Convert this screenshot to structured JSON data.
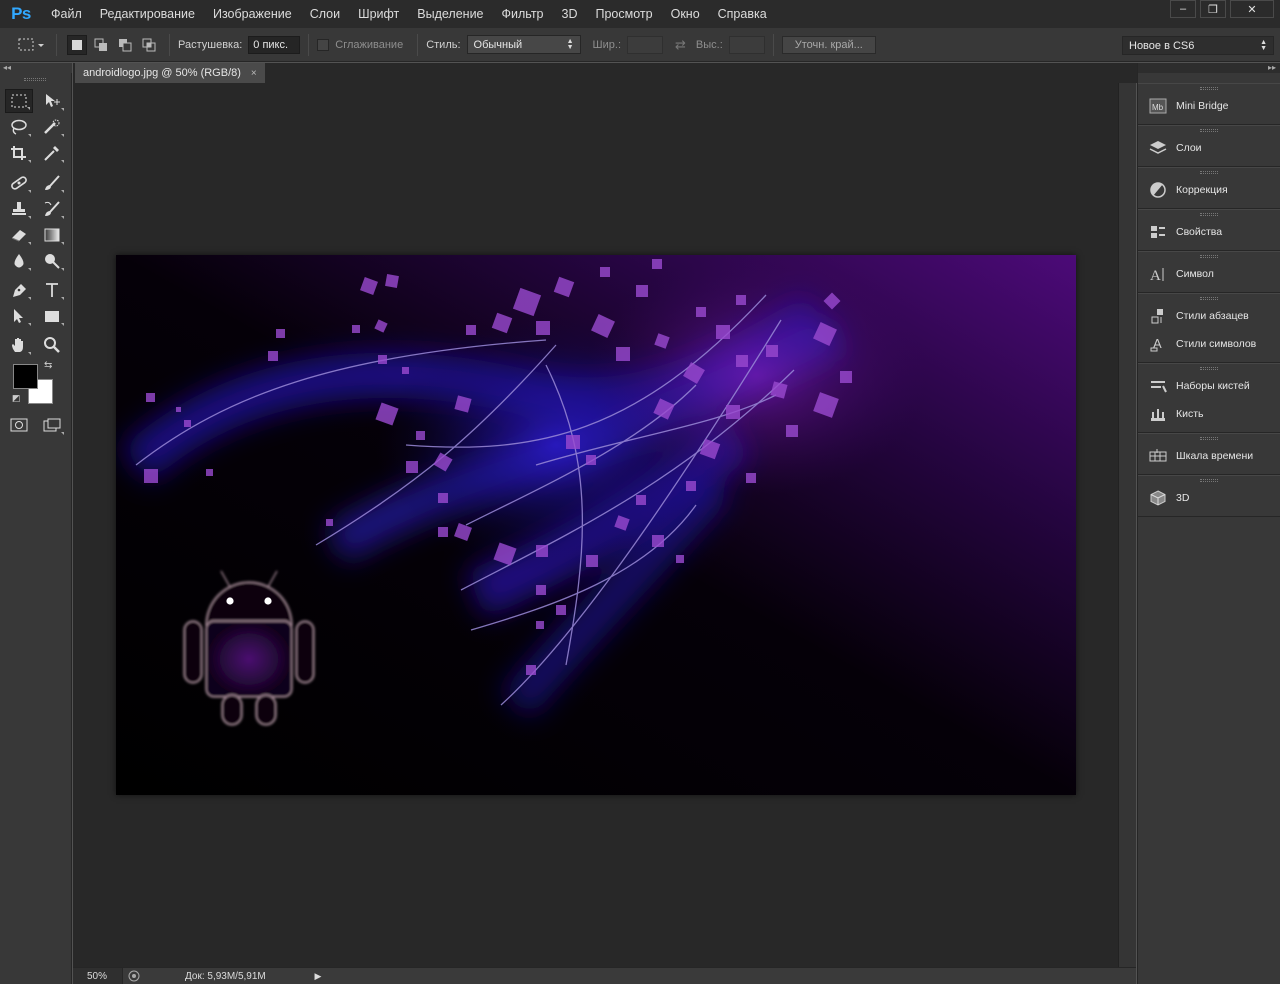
{
  "app": {
    "logo": "Ps"
  },
  "menu": [
    "Файл",
    "Редактирование",
    "Изображение",
    "Слои",
    "Шрифт",
    "Выделение",
    "Фильтр",
    "3D",
    "Просмотр",
    "Окно",
    "Справка"
  ],
  "window_controls": {
    "minimize": "–",
    "restore": "❐",
    "close": "✕"
  },
  "options": {
    "feather_label": "Растушевка:",
    "feather_value": "0 пикс.",
    "antialias_label": "Сглаживание",
    "style_label": "Стиль:",
    "style_value": "Обычный",
    "width_label": "Шир.:",
    "height_label": "Выс.:",
    "refine_edge": "Уточн. край...",
    "workspace": "Новое в CS6"
  },
  "document": {
    "tab_title": "androidlogo.jpg @ 50% (RGB/8)",
    "close": "×"
  },
  "status": {
    "zoom": "50%",
    "doc_info": "Док: 5,93M/5,91M"
  },
  "panels": [
    {
      "group": [
        {
          "label": "Mini Bridge",
          "icon": "mini-bridge-icon"
        }
      ]
    },
    {
      "group": [
        {
          "label": "Слои",
          "icon": "layers-icon"
        }
      ]
    },
    {
      "group": [
        {
          "label": "Коррекция",
          "icon": "adjustments-icon"
        }
      ]
    },
    {
      "group": [
        {
          "label": "Свойства",
          "icon": "properties-icon"
        }
      ]
    },
    {
      "group": [
        {
          "label": "Символ",
          "icon": "character-icon"
        }
      ]
    },
    {
      "group": [
        {
          "label": "Стили абзацев",
          "icon": "paragraph-styles-icon"
        },
        {
          "label": "Стили символов",
          "icon": "character-styles-icon"
        }
      ]
    },
    {
      "group": [
        {
          "label": "Наборы кистей",
          "icon": "brush-presets-icon"
        },
        {
          "label": "Кисть",
          "icon": "brush-icon"
        }
      ]
    },
    {
      "group": [
        {
          "label": "Шкала времени",
          "icon": "timeline-icon"
        }
      ]
    },
    {
      "group": [
        {
          "label": "3D",
          "icon": "3d-icon"
        }
      ]
    }
  ],
  "colors": {
    "foreground": "#000000",
    "background": "#ffffff",
    "accent": "#31a8ff"
  }
}
